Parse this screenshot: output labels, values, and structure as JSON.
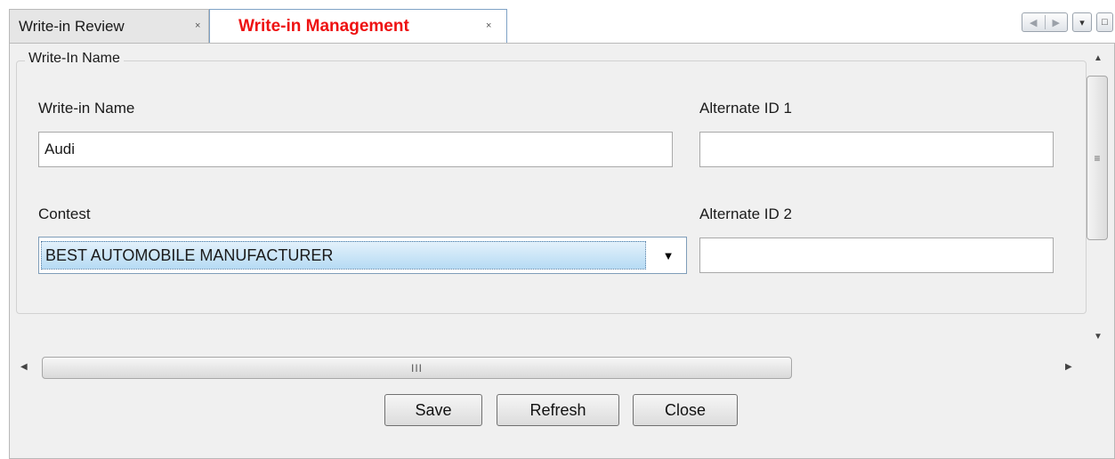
{
  "tabs": [
    {
      "label": "Write-in Review",
      "close": "×"
    },
    {
      "label": "Write-in Management",
      "close": "×"
    }
  ],
  "window_controls": {
    "prev": "◀",
    "next": "▶",
    "menu": "▾",
    "maximize": "□"
  },
  "group": {
    "legend": "Write-In Name"
  },
  "form": {
    "write_in_name_label": "Write-in Name",
    "write_in_name_value": "Audi",
    "alt_id1_label": "Alternate ID 1",
    "alt_id1_value": "",
    "contest_label": "Contest",
    "contest_value": "BEST AUTOMOBILE MANUFACTURER",
    "alt_id2_label": "Alternate ID 2",
    "alt_id2_value": ""
  },
  "scrollbars": {
    "up": "▲",
    "down": "▼",
    "left": "◀",
    "right": "▶",
    "v_grip": "≡",
    "h_grip": "III"
  },
  "buttons": {
    "save": "Save",
    "refresh": "Refresh",
    "close": "Close"
  }
}
